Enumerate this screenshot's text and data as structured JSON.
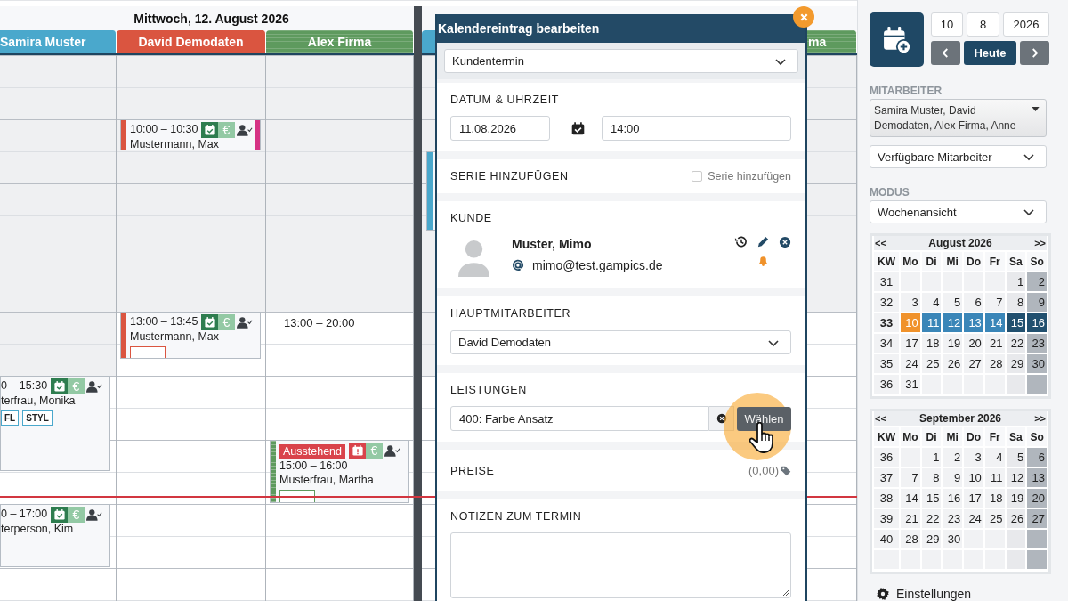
{
  "calendar": {
    "days": [
      {
        "title": "Mittwoch, 12. August 2026",
        "columns": [
          {
            "name": "Samira Muster",
            "color": "#4aa8cc",
            "striped": false,
            "events": [
              {
                "kind": "card",
                "time": "0 – 15:30",
                "client": "terfrau, Monika",
                "confirmed": true,
                "price_symbol": "€",
                "tags": [
                  "FL",
                  "STYL"
                ],
                "more_tags": false
              },
              {
                "kind": "card",
                "time": "0 – 17:00",
                "client": "terperson, Kim",
                "confirmed": true,
                "price_symbol": "€",
                "more_tags": false
              }
            ]
          },
          {
            "name": "David Demodaten",
            "color": "#da5540",
            "striped": false,
            "events": [
              {
                "kind": "card",
                "time": "10:00 – 10:30",
                "client": "Mustermann, Max",
                "confirmed": true,
                "price_symbol": "€",
                "color": "#d63384",
                "more_tags": false
              },
              {
                "kind": "card",
                "time": "13:00 – 13:45",
                "client": "Mustermann, Max",
                "confirmed": true,
                "price_symbol": "€",
                "more_tags": true
              }
            ]
          },
          {
            "name": "Alex Firma",
            "color": "#5e9a5e",
            "striped": true,
            "working_hours": "13:00 – 20:00",
            "events": [
              {
                "kind": "card",
                "badge": "Ausstehend",
                "time": "15:00 – 16:00",
                "client": "Musterfrau, Martha",
                "confirmed": false,
                "price_symbol": "€",
                "more_tags": true
              }
            ]
          }
        ]
      },
      {
        "columns": [
          {
            "color": "#4aa8cc",
            "striped": false,
            "events": [
              {
                "kind": "edge"
              }
            ]
          },
          {
            "name": "ma",
            "color": "#5e9a5e",
            "striped": true
          }
        ]
      }
    ]
  },
  "dialog": {
    "title": "Kalendereintrag bearbeiten",
    "type_select": "Kundentermin",
    "date_section": {
      "label": "DATUM & UHRZEIT",
      "date": "11.08.2026",
      "time": "14:00"
    },
    "series_section": {
      "label": "SERIE HINZUFÜGEN",
      "checkbox_label": "Serie hinzufügen",
      "checked": false
    },
    "customer_section": {
      "label": "KUNDE",
      "name": "Muster, Mimo",
      "email": "mimo@test.gampics.de"
    },
    "employee_section": {
      "label": "HAUPTMITARBEITER",
      "value": "David Demodaten"
    },
    "services_section": {
      "label": "LEISTUNGEN",
      "value": "400: Farbe Ansatz",
      "button": "Wählen"
    },
    "prices_section": {
      "label": "PREISE",
      "total": "(0,00)"
    },
    "notes_section": {
      "label": "NOTIZEN ZUM TERMIN"
    }
  },
  "sidebar": {
    "date_fields": [
      "10",
      "8",
      "2026"
    ],
    "today_button": "Heute",
    "employees_label": "MITARBEITER",
    "employees_value": "Samira Muster, David Demodaten, Alex Firma, Anne",
    "filter_select": "Verfügbare Mitarbeiter",
    "mode_label": "MODUS",
    "mode_select": "Wochenansicht",
    "month_calendars": [
      {
        "prev": "<<",
        "title": "August 2026",
        "next": ">>",
        "weekday_headers": [
          "KW",
          "Mo",
          "Di",
          "Mi",
          "Do",
          "Fr",
          "Sa",
          "So"
        ],
        "weeks": [
          {
            "kw": "31",
            "selected": false,
            "days": [
              {
                "kind": "blank"
              },
              {
                "kind": "blank"
              },
              {
                "kind": "blank"
              },
              {
                "kind": "blank"
              },
              {
                "kind": "blank"
              },
              {
                "d": "1",
                "today": false
              },
              {
                "d": "2",
                "today": false
              }
            ]
          },
          {
            "kw": "32",
            "selected": false,
            "days": [
              {
                "d": "3",
                "today": false
              },
              {
                "d": "4",
                "today": false
              },
              {
                "d": "5",
                "today": false
              },
              {
                "d": "6",
                "today": false
              },
              {
                "d": "7",
                "today": false
              },
              {
                "d": "8",
                "today": false
              },
              {
                "d": "9",
                "today": false
              }
            ]
          },
          {
            "kw": "33",
            "selected": true,
            "days": [
              {
                "d": "10",
                "today": true
              },
              {
                "d": "11",
                "today": false
              },
              {
                "d": "12",
                "today": false
              },
              {
                "d": "13",
                "today": false
              },
              {
                "d": "14",
                "today": false
              },
              {
                "d": "15",
                "today": false
              },
              {
                "d": "16",
                "today": false
              }
            ]
          },
          {
            "kw": "34",
            "selected": false,
            "days": [
              {
                "d": "17",
                "today": false
              },
              {
                "d": "18",
                "today": false
              },
              {
                "d": "19",
                "today": false
              },
              {
                "d": "20",
                "today": false
              },
              {
                "d": "21",
                "today": false
              },
              {
                "d": "22",
                "today": false
              },
              {
                "d": "23",
                "today": false
              }
            ]
          },
          {
            "kw": "35",
            "selected": false,
            "days": [
              {
                "d": "24",
                "today": false
              },
              {
                "d": "25",
                "today": false
              },
              {
                "d": "26",
                "today": false
              },
              {
                "d": "27",
                "today": false
              },
              {
                "d": "28",
                "today": false
              },
              {
                "d": "29",
                "today": false
              },
              {
                "d": "30",
                "today": false
              }
            ]
          },
          {
            "kw": "36",
            "selected": false,
            "days": [
              {
                "d": "31",
                "today": false
              },
              {
                "kind": "blank"
              },
              {
                "kind": "blank"
              },
              {
                "kind": "blank"
              },
              {
                "kind": "blank"
              },
              {
                "kind": "blank"
              },
              {
                "kind": "blank"
              }
            ]
          }
        ]
      },
      {
        "prev": "<<",
        "title": "September 2026",
        "next": ">>",
        "weekday_headers": [
          "KW",
          "Mo",
          "Di",
          "Mi",
          "Do",
          "Fr",
          "Sa",
          "So"
        ],
        "weeks": [
          {
            "kw": "36",
            "selected": false,
            "days": [
              {
                "kind": "blank"
              },
              {
                "d": "1",
                "today": false
              },
              {
                "d": "2",
                "today": false
              },
              {
                "d": "3",
                "today": false
              },
              {
                "d": "4",
                "today": false
              },
              {
                "d": "5",
                "today": false
              },
              {
                "d": "6",
                "today": false
              }
            ]
          },
          {
            "kw": "37",
            "selected": false,
            "days": [
              {
                "d": "7",
                "today": false
              },
              {
                "d": "8",
                "today": false
              },
              {
                "d": "9",
                "today": false
              },
              {
                "d": "10",
                "today": false
              },
              {
                "d": "11",
                "today": false
              },
              {
                "d": "12",
                "today": false
              },
              {
                "d": "13",
                "today": false
              }
            ]
          },
          {
            "kw": "38",
            "selected": false,
            "days": [
              {
                "d": "14",
                "today": false
              },
              {
                "d": "15",
                "today": false
              },
              {
                "d": "16",
                "today": false
              },
              {
                "d": "17",
                "today": false
              },
              {
                "d": "18",
                "today": false
              },
              {
                "d": "19",
                "today": false
              },
              {
                "d": "20",
                "today": false
              }
            ]
          },
          {
            "kw": "39",
            "selected": false,
            "days": [
              {
                "d": "21",
                "today": false
              },
              {
                "d": "22",
                "today": false
              },
              {
                "d": "23",
                "today": false
              },
              {
                "d": "24",
                "today": false
              },
              {
                "d": "25",
                "today": false
              },
              {
                "d": "26",
                "today": false
              },
              {
                "d": "27",
                "today": false
              }
            ]
          },
          {
            "kw": "40",
            "selected": false,
            "days": [
              {
                "d": "28",
                "today": false
              },
              {
                "d": "29",
                "today": false
              },
              {
                "d": "30",
                "today": false
              },
              {
                "kind": "blank"
              },
              {
                "kind": "blank"
              },
              {
                "kind": "blank"
              },
              {
                "kind": "blank"
              }
            ]
          },
          {
            "days": [
              {
                "kind": "blank"
              },
              {
                "kind": "blank"
              },
              {
                "kind": "blank"
              },
              {
                "kind": "blank"
              },
              {
                "kind": "blank"
              },
              {
                "kind": "blank"
              },
              {
                "kind": "blank"
              }
            ]
          }
        ]
      }
    ],
    "settings_link": "Einstellungen"
  }
}
